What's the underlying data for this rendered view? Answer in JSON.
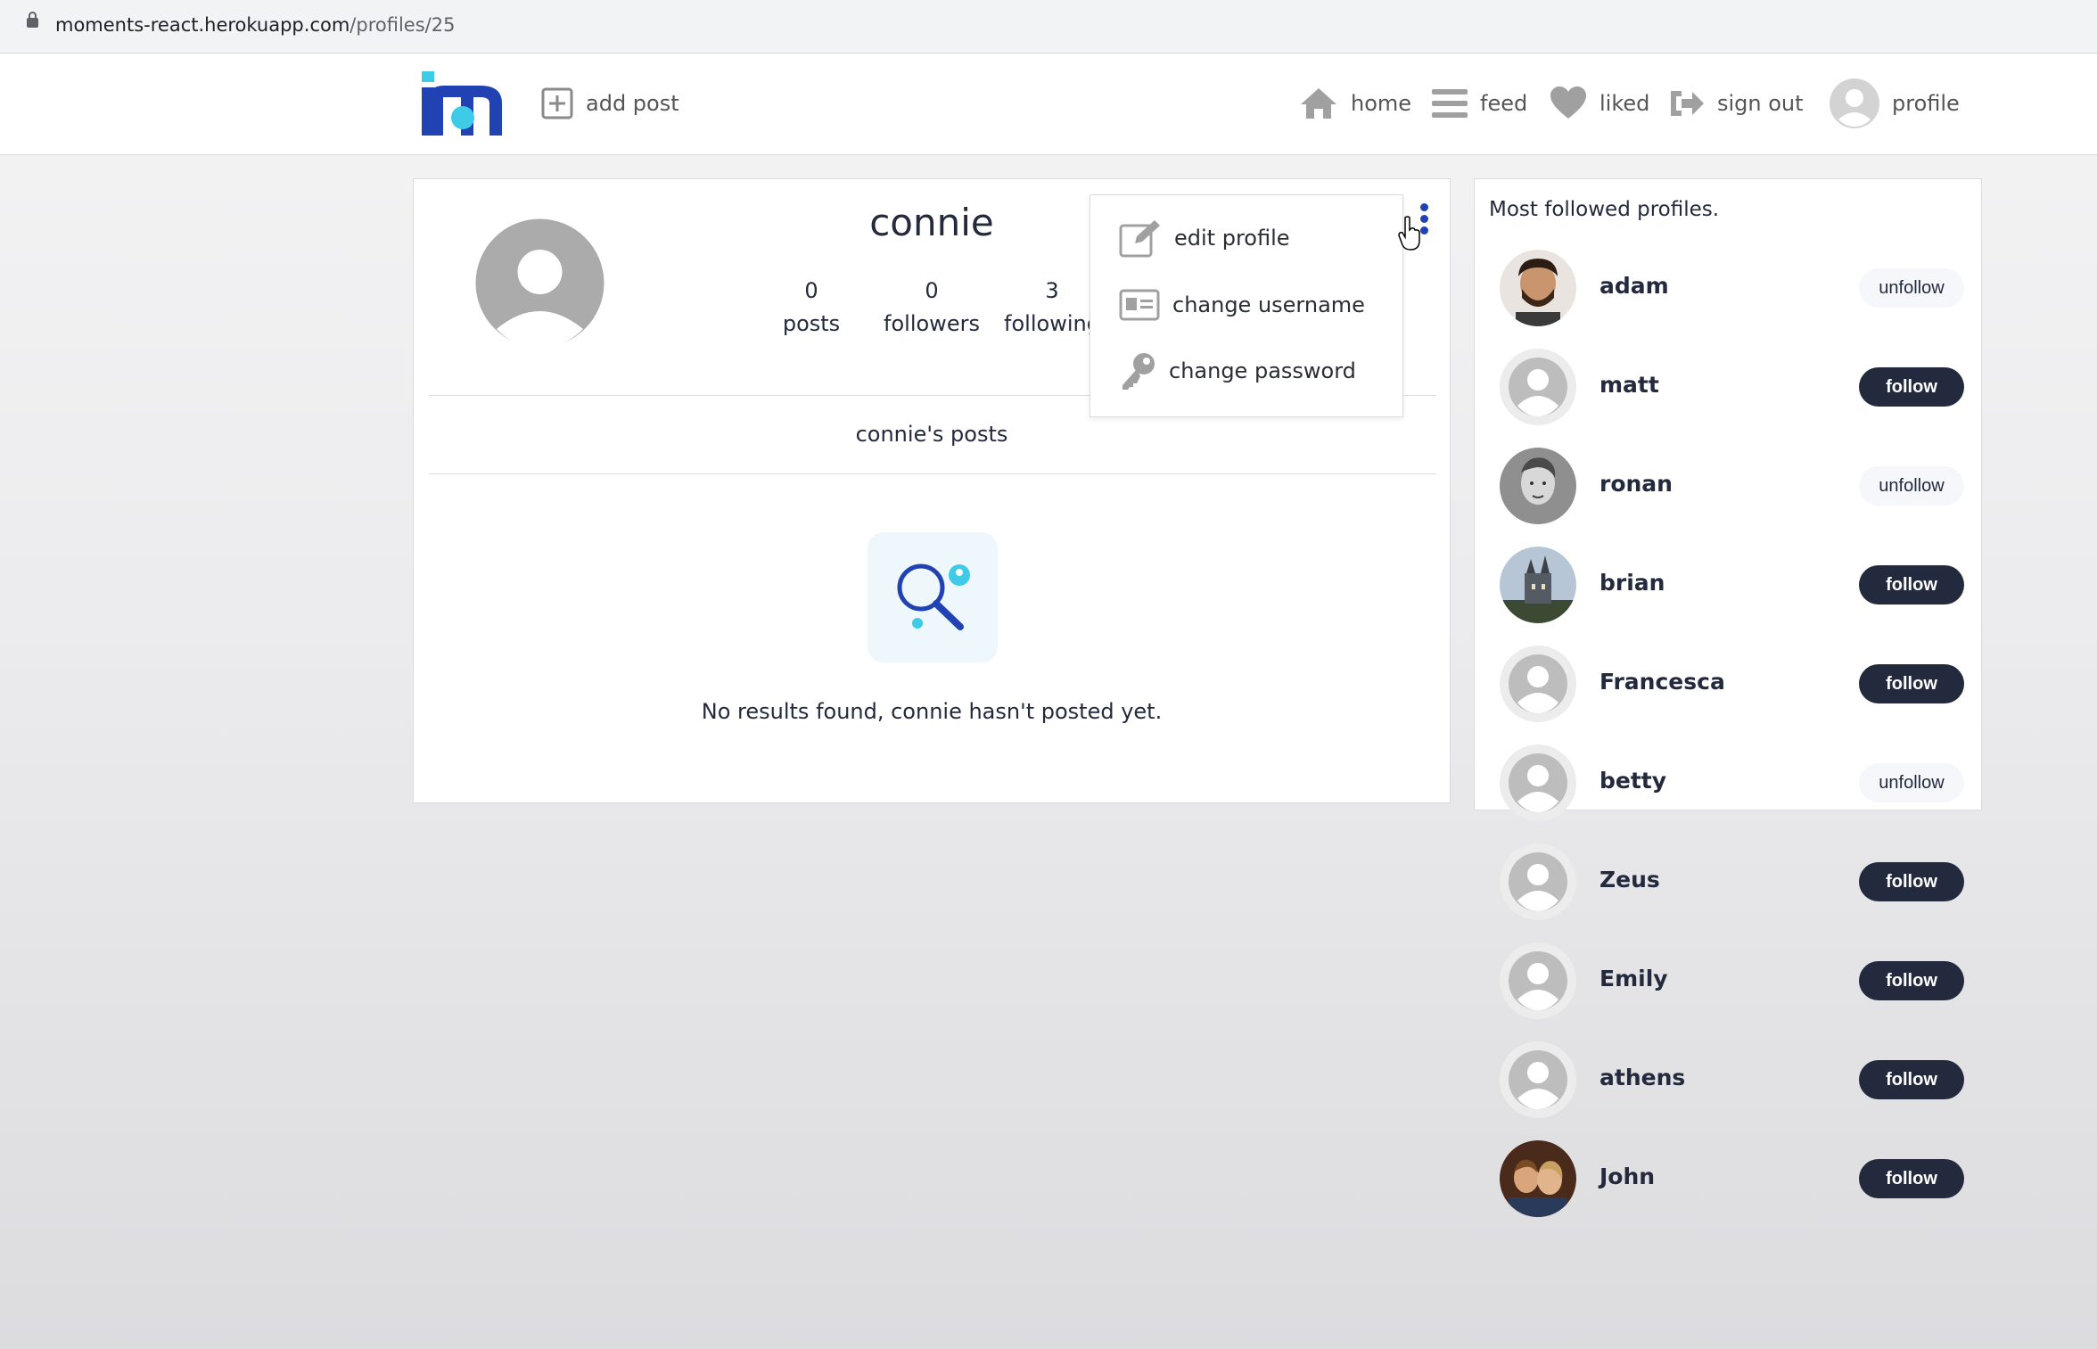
{
  "browser": {
    "url_host": "moments-react.herokuapp.com",
    "url_path": "/profiles/25"
  },
  "nav": {
    "add_post": "add post",
    "home": "home",
    "feed": "feed",
    "liked": "liked",
    "sign_out": "sign out",
    "profile": "profile"
  },
  "profile": {
    "username": "connie",
    "stats": [
      {
        "value": "0",
        "label": "posts"
      },
      {
        "value": "0",
        "label": "followers"
      },
      {
        "value": "3",
        "label": "following"
      }
    ],
    "posts_title": "connie's posts",
    "no_results": "No results found, connie hasn't posted yet."
  },
  "dropdown": {
    "items": [
      {
        "label": "edit profile",
        "icon": "edit-icon"
      },
      {
        "label": "change username",
        "icon": "id-card-icon"
      },
      {
        "label": "change password",
        "icon": "key-icon"
      }
    ]
  },
  "most_followed": {
    "title": "Most followed profiles.",
    "profiles": [
      {
        "name": "adam",
        "action": "unfollow",
        "avatar": "photo-man"
      },
      {
        "name": "matt",
        "action": "follow",
        "avatar": "default"
      },
      {
        "name": "ronan",
        "action": "unfollow",
        "avatar": "photo-sketch"
      },
      {
        "name": "brian",
        "action": "follow",
        "avatar": "photo-castle"
      },
      {
        "name": "Francesca",
        "action": "follow",
        "avatar": "default"
      },
      {
        "name": "betty",
        "action": "unfollow",
        "avatar": "default"
      },
      {
        "name": "Zeus",
        "action": "follow",
        "avatar": "default"
      },
      {
        "name": "Emily",
        "action": "follow",
        "avatar": "default"
      },
      {
        "name": "athens",
        "action": "follow",
        "avatar": "default"
      },
      {
        "name": "John",
        "action": "follow",
        "avatar": "photo-couple"
      }
    ]
  },
  "colors": {
    "brand_blue": "#2142b2",
    "brand_cyan": "#3ecbe8",
    "dark_button": "#242a3d"
  }
}
